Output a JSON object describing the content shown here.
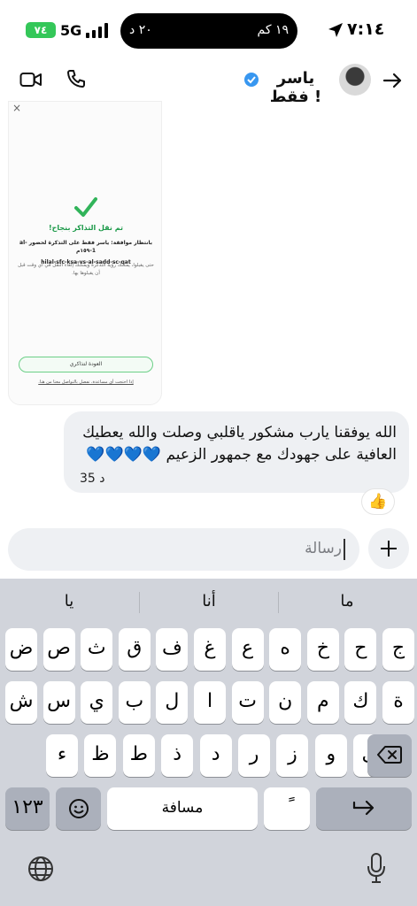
{
  "status_bar": {
    "battery": "٧٤",
    "network": "5G",
    "island_left": "٢٠ د",
    "island_right": "١٩ كم",
    "time": "٧:١٤"
  },
  "header": {
    "contact_name": "ياسر فقط !",
    "verified_color": "#3897f0"
  },
  "shared_card": {
    "close": "×",
    "title": "تم نقل التذاكر بنجاح!",
    "line1": "بانتظار موافقة: ياسر فقط على التذكرة لحضور al-1-١٥٩م",
    "line2": "hilal-sfc-ksa-vs-al-sadd-sc-qat",
    "line3": "حتى يقبلوا، يمكنك رؤية التذكرة ويمكنك إلغاء النقل في أي وقت قبل أن يقبلوها بها.",
    "button": "العودة لتذاكري",
    "help": "إذا احتجت أي مساعدة، تفضل بالتواصل معنا من هنا."
  },
  "message": {
    "text": "الله يوفقنا يارب مشكور ياقلبي وصلت والله يعطيك العافية على جهودك مع جمهور الزعيم 💙💙💙💙",
    "time": "35 د",
    "reaction": "👍"
  },
  "composer": {
    "placeholder": "رسالة"
  },
  "keyboard": {
    "suggestions": [
      "ما",
      "أنا",
      "يا"
    ],
    "row1": [
      "ج",
      "ح",
      "خ",
      "ه",
      "ع",
      "غ",
      "ف",
      "ق",
      "ث",
      "ص",
      "ض"
    ],
    "row2": [
      "ة",
      "ك",
      "م",
      "ن",
      "ت",
      "ا",
      "ل",
      "ب",
      "ي",
      "س",
      "ش"
    ],
    "row3": [
      "ى",
      "و",
      "ز",
      "ر",
      "د",
      "ذ",
      "ط",
      "ظ",
      "ء"
    ],
    "numbers_key": "١٢٣",
    "space_key": "مسافة",
    "diacritic_key": "ً",
    "icons": {
      "globe": "globe-icon",
      "mic": "microphone-icon",
      "return": "return-icon",
      "delete": "delete-icon",
      "emoji": "emoji-icon"
    }
  }
}
